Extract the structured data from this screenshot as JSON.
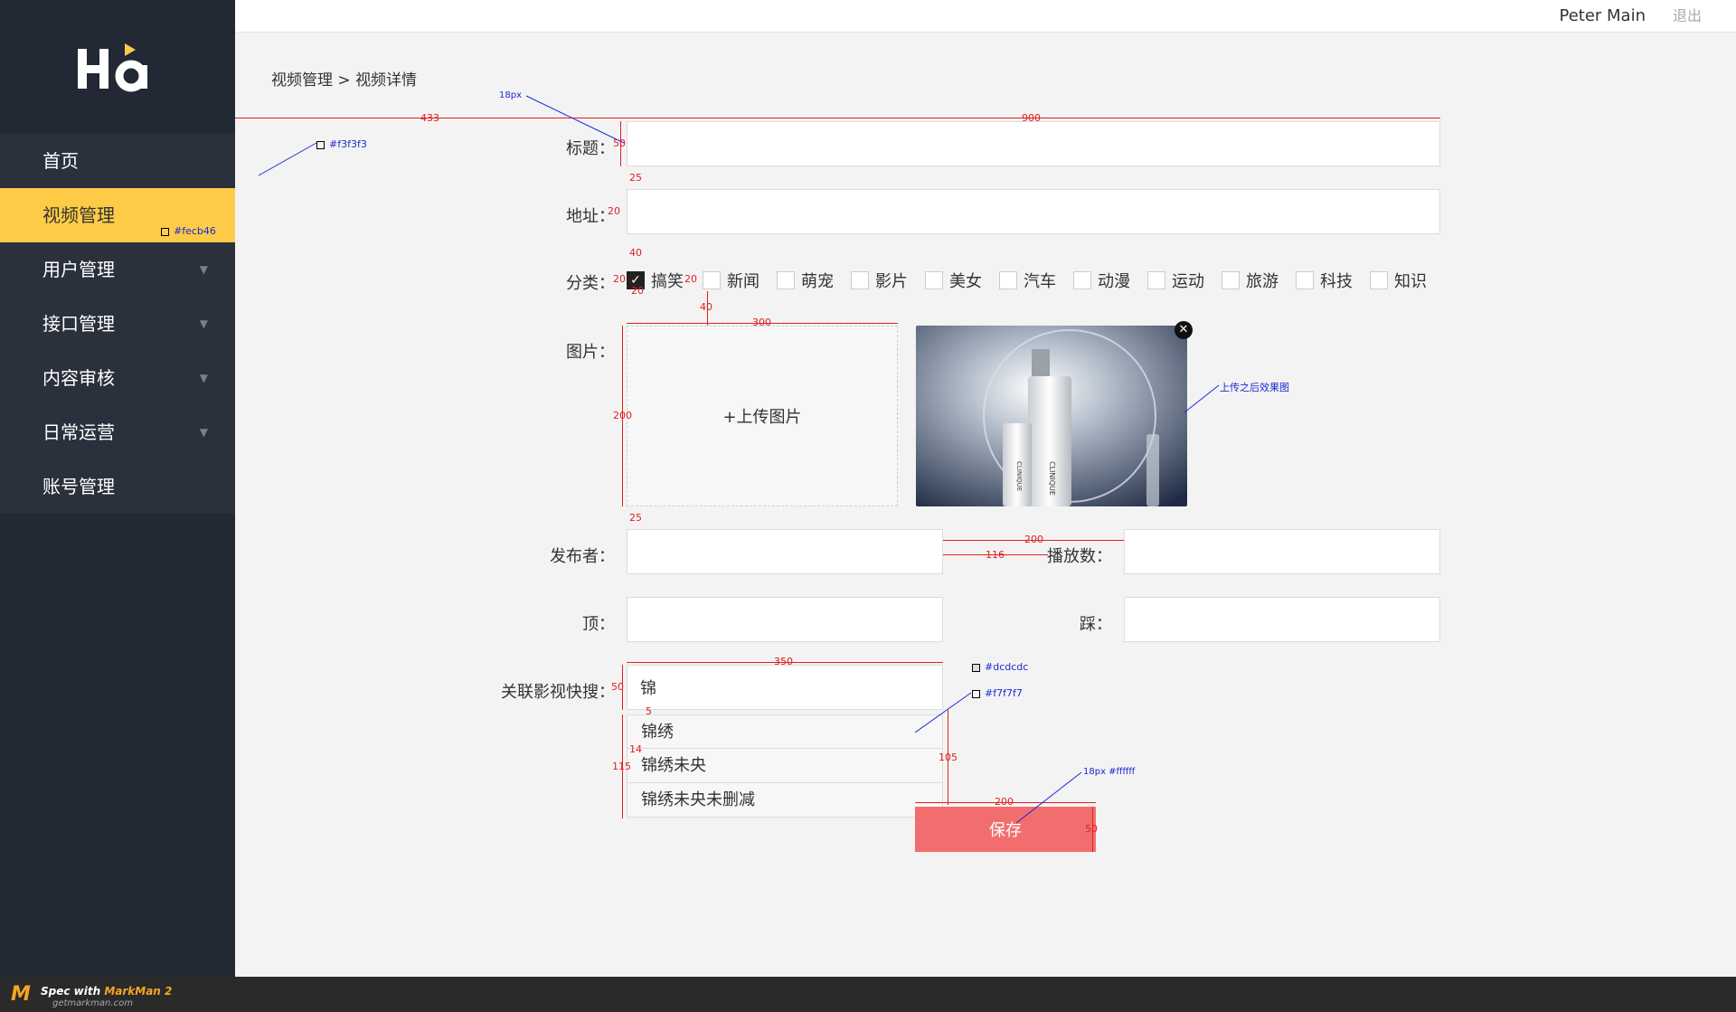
{
  "sidebar": {
    "logo_text": "Ha",
    "items": [
      {
        "label": "首页",
        "has_arrow": false,
        "active": false
      },
      {
        "label": "视频管理",
        "has_arrow": false,
        "active": true
      },
      {
        "label": "用户管理",
        "has_arrow": true,
        "active": false
      },
      {
        "label": "接口管理",
        "has_arrow": true,
        "active": false
      },
      {
        "label": "内容审核",
        "has_arrow": true,
        "active": false
      },
      {
        "label": "日常运营",
        "has_arrow": true,
        "active": false
      },
      {
        "label": "账号管理",
        "has_arrow": false,
        "active": false
      }
    ],
    "arrow_glyph": "▼"
  },
  "header": {
    "username": "Peter Main",
    "logout_label": "退出"
  },
  "breadcrumb": {
    "parent": "视频管理",
    "separator": ">",
    "current": "视频详情"
  },
  "form": {
    "title_label": "标题：",
    "title_value": "",
    "url_label": "地址：",
    "url_value": "",
    "category_label": "分类：",
    "categories": [
      {
        "label": "搞笑",
        "checked": true
      },
      {
        "label": "新闻",
        "checked": false
      },
      {
        "label": "萌宠",
        "checked": false
      },
      {
        "label": "影片",
        "checked": false
      },
      {
        "label": "美女",
        "checked": false
      },
      {
        "label": "汽车",
        "checked": false
      },
      {
        "label": "动漫",
        "checked": false
      },
      {
        "label": "运动",
        "checked": false
      },
      {
        "label": "旅游",
        "checked": false
      },
      {
        "label": "科技",
        "checked": false
      },
      {
        "label": "知识",
        "checked": false
      }
    ],
    "image_label": "图片：",
    "upload_label": "+上传图片",
    "publisher_label": "发布者：",
    "publisher_value": "",
    "plays_label": "播放数：",
    "plays_value": "",
    "up_label": "顶：",
    "up_value": "",
    "down_label": "踩：",
    "down_value": "",
    "related_label": "关联影视快搜：",
    "related_value": "锦",
    "suggestions": [
      "锦绣",
      "锦绣未央",
      "锦绣未央未删减"
    ],
    "save_label": "保存"
  },
  "annotations": {
    "font_18px": "18px",
    "bg_color": "#f3f3f3",
    "active_color": "#fecb46",
    "border_color": "#dcdcdc",
    "sugg_bg": "#f7f7f7",
    "btn_text": "18px #ffffff",
    "after_upload": "上传之后效果图",
    "d433": "433",
    "d900": "900",
    "d50a": "50",
    "d25a": "25",
    "d20a": "20",
    "d40a": "40",
    "d20b": "20",
    "d20c": "20",
    "d20d": "20",
    "d40b": "40",
    "d300": "300",
    "d200a": "200",
    "d25b": "25",
    "d200b": "200",
    "d116": "116",
    "d350": "350",
    "d50b": "50",
    "d5": "5",
    "d14": "14",
    "d115": "115",
    "d105": "105",
    "d200c": "200",
    "d50c": "50"
  },
  "footer": {
    "markman_prefix": "Spec with ",
    "markman_name": "MarkMan 2",
    "markman_url": "getmarkman.com"
  },
  "colors": {
    "sidebar_bg": "#222834",
    "nav_item_bg": "#2a303c",
    "active": "#fecb46",
    "page_bg": "#f3f3f3",
    "save_btn": "#f26e6e"
  }
}
